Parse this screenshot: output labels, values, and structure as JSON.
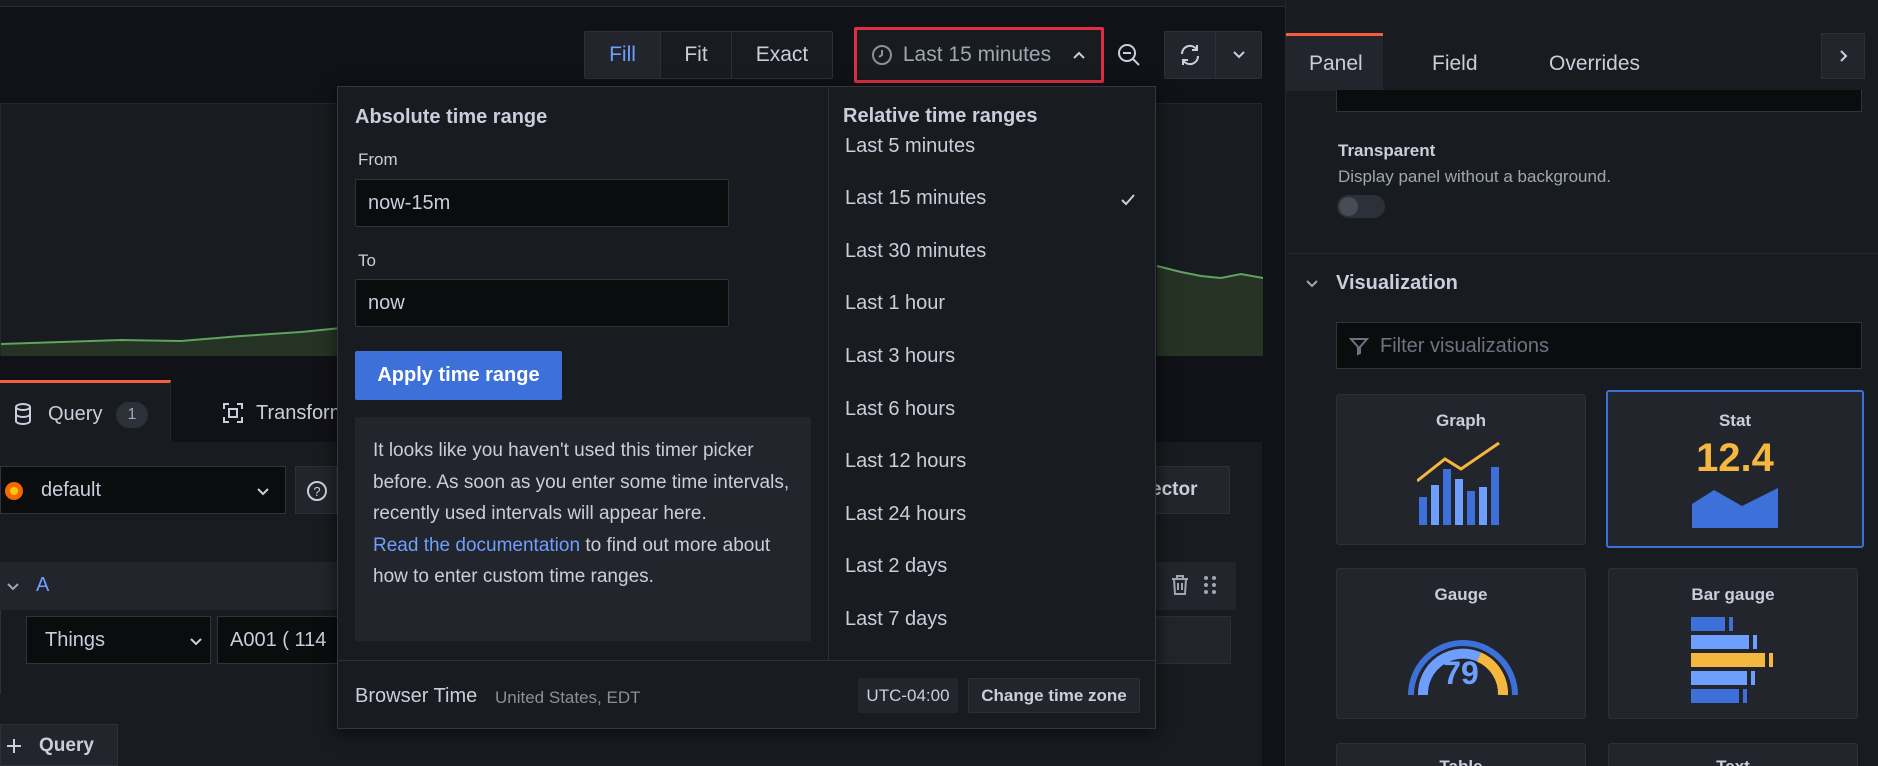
{
  "toolbar": {
    "fill": "Fill",
    "fit": "Fit",
    "exact": "Exact",
    "time_range": "Last 15 minutes",
    "time_icon": "clock-icon",
    "zoom_icon": "zoom-out-icon",
    "refresh_icon": "refresh-icon"
  },
  "picker": {
    "absolute_title": "Absolute time range",
    "from_label": "From",
    "from_value": "now-15m",
    "to_label": "To",
    "to_value": "now",
    "apply": "Apply time range",
    "info_text": "It looks like you haven't used this timer picker before. As soon as you enter some time intervals, recently used intervals will appear here.",
    "info_link": "Read the documentation",
    "info_suffix": " to find out more about how to enter custom time ranges.",
    "relative_title": "Relative time ranges",
    "relative": [
      "Last 5 minutes",
      "Last 15 minutes",
      "Last 30 minutes",
      "Last 1 hour",
      "Last 3 hours",
      "Last 6 hours",
      "Last 12 hours",
      "Last 24 hours",
      "Last 2 days",
      "Last 7 days"
    ],
    "selected_index": 1,
    "browser_time": "Browser Time",
    "region": "United States, EDT",
    "utc": "UTC-04:00",
    "change_tz": "Change time zone"
  },
  "query": {
    "tab_query": "Query",
    "tab_query_count": "1",
    "tab_transform": "Transform",
    "datasource": "default",
    "selector_partial": "ector",
    "row_letter": "A",
    "things": "Things",
    "a001": "A001 ( 114",
    "add_query": "Query"
  },
  "sidebar": {
    "tabs": [
      "Panel",
      "Field",
      "Overrides"
    ],
    "transparent_label": "Transparent",
    "transparent_desc": "Display panel without a background.",
    "visualization": "Visualization",
    "filter_placeholder": "Filter visualizations",
    "viz": {
      "graph": "Graph",
      "stat": "Stat",
      "stat_value": "12.4",
      "gauge": "Gauge",
      "gauge_value": "79",
      "bar_gauge": "Bar gauge",
      "table": "Table",
      "text": "Text"
    }
  },
  "colors": {
    "accent": "#3d71d9",
    "link": "#6e9fff",
    "highlight_red": "#e02f44",
    "stat_yellow": "#f5b73d",
    "bg": "#111217"
  }
}
